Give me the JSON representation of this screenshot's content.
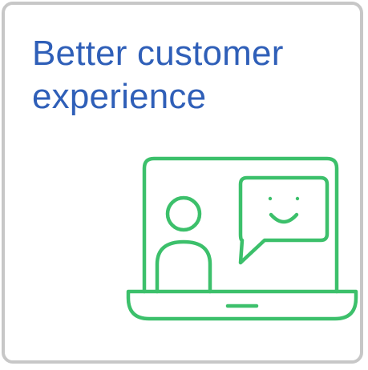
{
  "card": {
    "title": "Better customer experience"
  },
  "icon": {
    "name": "video-call-laptop-icon"
  },
  "colors": {
    "title": "#2f5fb8",
    "illustration_stroke": "#3cc06b",
    "card_border": "#c7c7c7"
  }
}
